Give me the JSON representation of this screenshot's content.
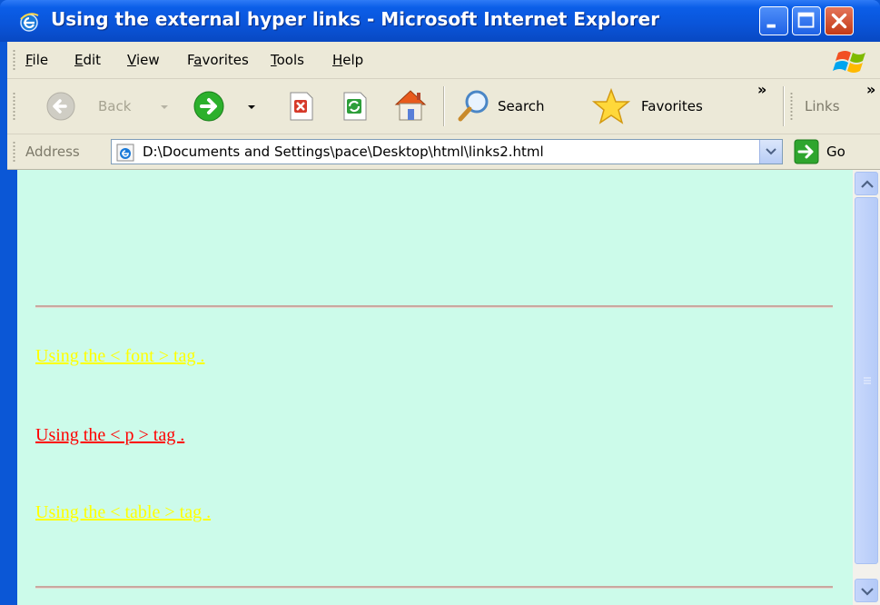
{
  "window": {
    "title": "Using the external hyper links - Microsoft Internet Explorer"
  },
  "menu": {
    "items": [
      {
        "key": "F",
        "rest": "ile"
      },
      {
        "key": "E",
        "rest": "dit"
      },
      {
        "key": "V",
        "rest": "iew"
      },
      {
        "pre": "F",
        "key": "a",
        "rest": "vorites"
      },
      {
        "key": "T",
        "rest": "ools"
      },
      {
        "key": "H",
        "rest": "elp"
      }
    ]
  },
  "toolbar": {
    "back_label": "Back",
    "search_label": "Search",
    "favorites_label": "Favorites",
    "chevron": "»",
    "links_label": "Links",
    "links_chevron": "»"
  },
  "address": {
    "label": "Address",
    "url": "D:\\Documents and Settings\\pace\\Desktop\\html\\links2.html",
    "go_label": "Go"
  },
  "page": {
    "background": "#ccfbea",
    "links": [
      {
        "text": "Using the < font > tag .",
        "color": "#ffff00"
      },
      {
        "text": "Using the < p > tag .",
        "color": "#ff0000"
      },
      {
        "text": "Using the < table > tag .",
        "color": "#ffff00"
      }
    ]
  }
}
